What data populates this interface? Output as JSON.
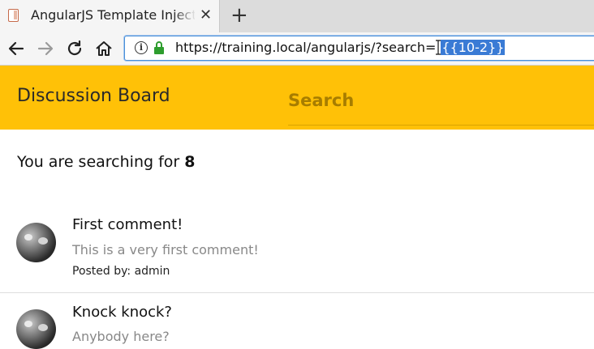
{
  "browser": {
    "tab": {
      "title": "AngularJS Template Injection",
      "close_label": "✕"
    },
    "new_tab_label": "+",
    "url": {
      "prefix": "https://training.local/angularjs/?search=",
      "selected": "{{10-2}}"
    }
  },
  "header": {
    "brand": "Discussion Board",
    "search_placeholder": "Search",
    "color": "#ffc107"
  },
  "search_result": {
    "prefix": "You are searching for ",
    "value": "8"
  },
  "comments": [
    {
      "title": "First comment!",
      "body": "This is a very first comment!",
      "author_label": "Posted by: admin"
    },
    {
      "title": "Knock knock?",
      "body": "Anybody here?"
    }
  ]
}
